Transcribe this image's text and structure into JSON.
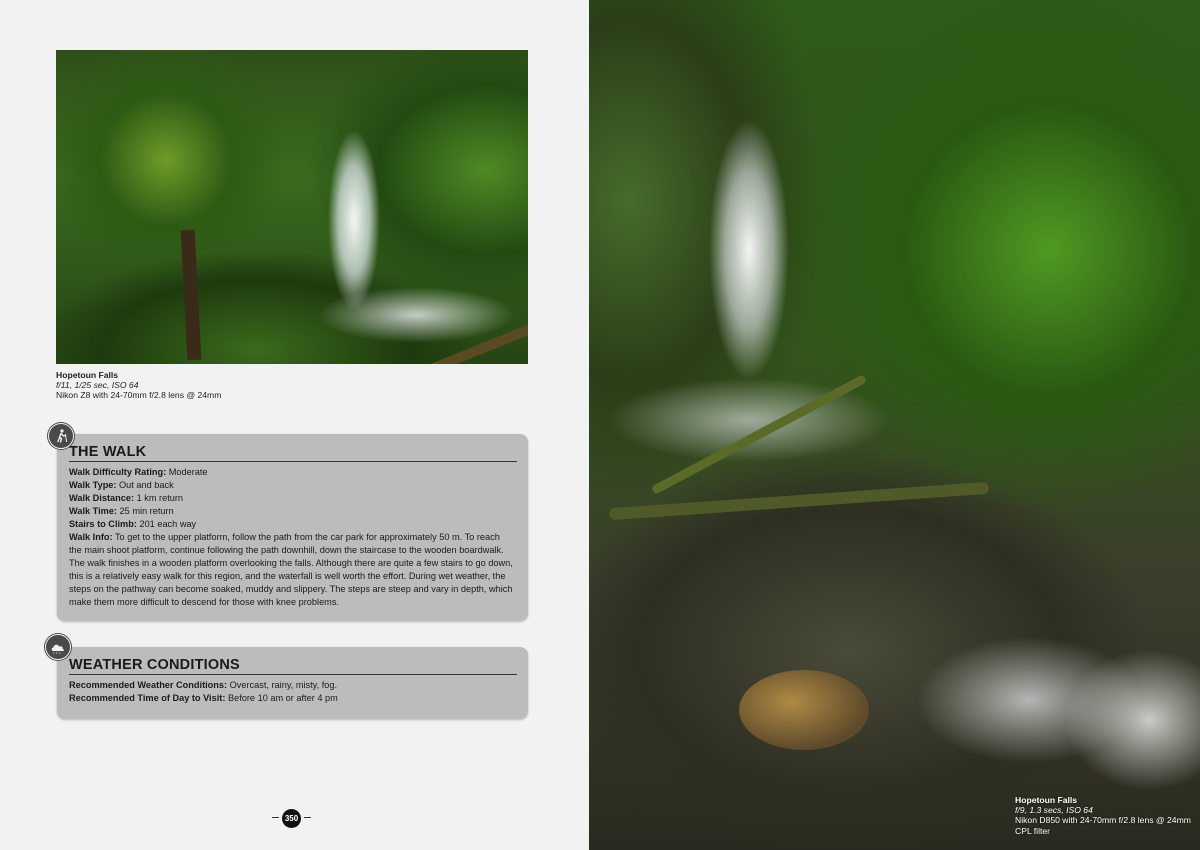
{
  "photo_top": {
    "caption_title": "Hopetoun Falls",
    "caption_settings": "f/11, 1/25 sec, ISO 64",
    "caption_gear": "Nikon Z8 with 24-70mm f/2.8 lens @ 24mm"
  },
  "walk": {
    "heading": "The Walk",
    "rows": [
      {
        "label": "Walk Difficulty Rating:",
        "value": " Moderate"
      },
      {
        "label": "Walk Type:",
        "value": " Out and back"
      },
      {
        "label": "Walk Distance:",
        "value": " 1 km return"
      },
      {
        "label": "Walk Time:",
        "value": " 25 min return"
      },
      {
        "label": "Stairs to Climb:",
        "value": " 201 each way"
      },
      {
        "label": "Walk Info:",
        "value": " To get to the upper platform, follow the path from the car park for approximately 50 m. To reach the main shoot platform, continue following the path downhill, down the staircase to the wooden boardwalk. The walk finishes in a wooden platform overlooking the falls. Although there are quite a few stairs to go down, this is a relatively easy walk for this region, and the waterfall is well worth the effort. During wet weather, the steps on the pathway can become soaked, muddy and slippery. The steps are steep and vary in depth, which make them more difficult to descend for those with knee problems."
      }
    ]
  },
  "weather": {
    "heading": "Weather Conditions",
    "rows": [
      {
        "label": "Recommended Weather Conditions:",
        "value": " Overcast, rainy, misty, fog."
      },
      {
        "label": "Recommended Time of Day to Visit:",
        "value": " Before 10 am or after 4 pm"
      }
    ]
  },
  "page_number": "350",
  "photo_right": {
    "caption_title": "Hopetoun Falls",
    "caption_settings": "f/9, 1.3 secs, ISO 64",
    "caption_gear": "Nikon D850 with 24-70mm f/2.8 lens @ 24mm",
    "caption_filter": "CPL filter"
  },
  "icons": {
    "walk_badge": "hiker-icon",
    "weather_badge": "cloud-icon"
  },
  "colors": {
    "panel_bg": "#bcbcbc",
    "badge_bg": "#4a4a4a",
    "page_bg": "#f2f2f2"
  }
}
